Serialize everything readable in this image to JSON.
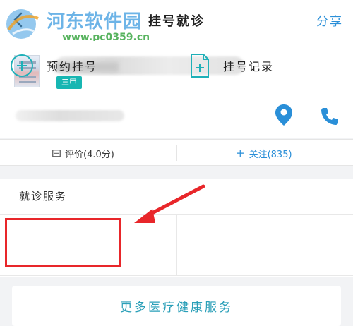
{
  "header": {
    "title": "挂号就诊",
    "share_label": "分享"
  },
  "watermark": {
    "text": "河东软件园",
    "url": "www.pc0359.cn"
  },
  "hospital": {
    "level_badge": "三甲"
  },
  "actions": {
    "rating_label": "评价(4.0分)",
    "follow_label": "关注(835)"
  },
  "service": {
    "section_title": "就诊服务",
    "book_label": "预约挂号",
    "record_label": "挂号记录"
  },
  "more_services_label": "更多医疗健康服务",
  "colors": {
    "accent_blue": "#2a8fd8",
    "teal_badge": "#17b6b2",
    "highlight_red": "#e8262a",
    "service_teal": "#2a9fb8"
  }
}
